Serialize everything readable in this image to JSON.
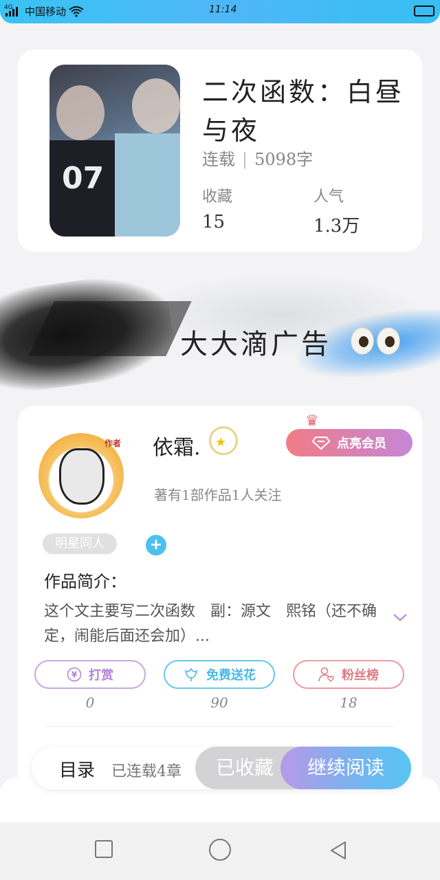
{
  "status_bar": {
    "network": "4G",
    "carrier": "中国移动",
    "time": "11:14"
  },
  "book": {
    "title": "二次函数：白昼与夜",
    "status": "连载",
    "word_count": "5098字",
    "favorites_label": "收藏",
    "favorites_value": "15",
    "popularity_label": "人气",
    "popularity_value": "1.3万"
  },
  "ad": {
    "text": "大大滴广告"
  },
  "author": {
    "avatar_tag": "作者",
    "name": "依霜.",
    "info": "著有1部作品1人关注",
    "vip_label": "点亮会员",
    "genre_tag": "明星同人",
    "add_tag": "+",
    "intro_heading": "作品简介：",
    "intro_text": "这个文主要写二次函数　副：源文　熙铭（还不确定，闹能后面还会加）..."
  },
  "actions": {
    "reward_label": "打赏",
    "reward_count": "0",
    "flower_label": "免费送花",
    "flower_count": "90",
    "fans_label": "粉丝榜",
    "fans_count": "18"
  },
  "bottom_bar": {
    "catalog_label": "目录",
    "chapters_label": "已连载4章",
    "collected_label": "已收藏",
    "continue_label": "继续阅读"
  },
  "colors": {
    "accent_blue": "#4fb7f7",
    "vip_gradient_start": "#f17c86",
    "vip_gradient_end": "#c586d8"
  }
}
